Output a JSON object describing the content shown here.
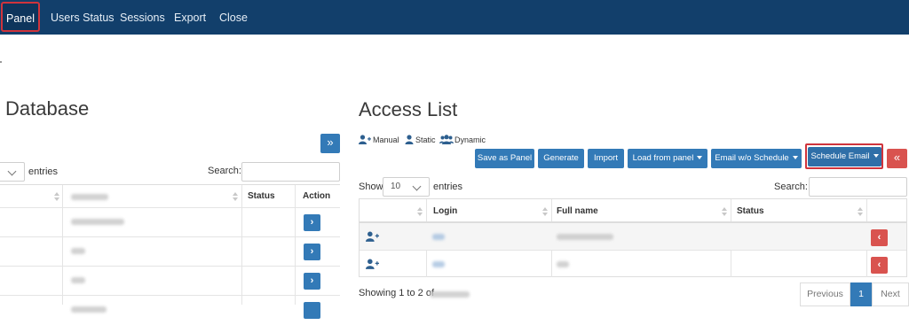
{
  "nav": {
    "items": [
      "Panel",
      "Users Status",
      "Sessions",
      "Export",
      "Close"
    ],
    "active": "Panel"
  },
  "database": {
    "title": "Database",
    "entries_label": "entries",
    "search_label": "Search:",
    "columns": [
      "",
      "",
      "Status",
      "Action"
    ],
    "move_all_glyph": "»",
    "row_action_glyph": "›"
  },
  "access": {
    "title": "Access List",
    "legend": [
      "Manual",
      "Static",
      "Dynamic"
    ],
    "toolbar": {
      "save_as_panel": "Save as Panel",
      "generate": "Generate",
      "import": "Import",
      "load_from_panel": "Load from panel",
      "email_wo_schedule": "Email w/o Schedule",
      "schedule_email": "Schedule Email",
      "remove_all_glyph": "«"
    },
    "show_label": "Show",
    "page_size": "10",
    "entries_label": "entries",
    "search_label": "Search:",
    "columns": [
      "",
      "Login",
      "Full name",
      "Status",
      ""
    ],
    "row_action_glyph": "‹",
    "info_prefix": "Showing 1 to 2 of",
    "pagination": {
      "previous": "Previous",
      "current": "1",
      "next": "Next"
    }
  },
  "colors": {
    "nav_bg": "#123f6b",
    "primary": "#337ab7",
    "danger": "#d9534f",
    "highlight": "#d0343c"
  }
}
